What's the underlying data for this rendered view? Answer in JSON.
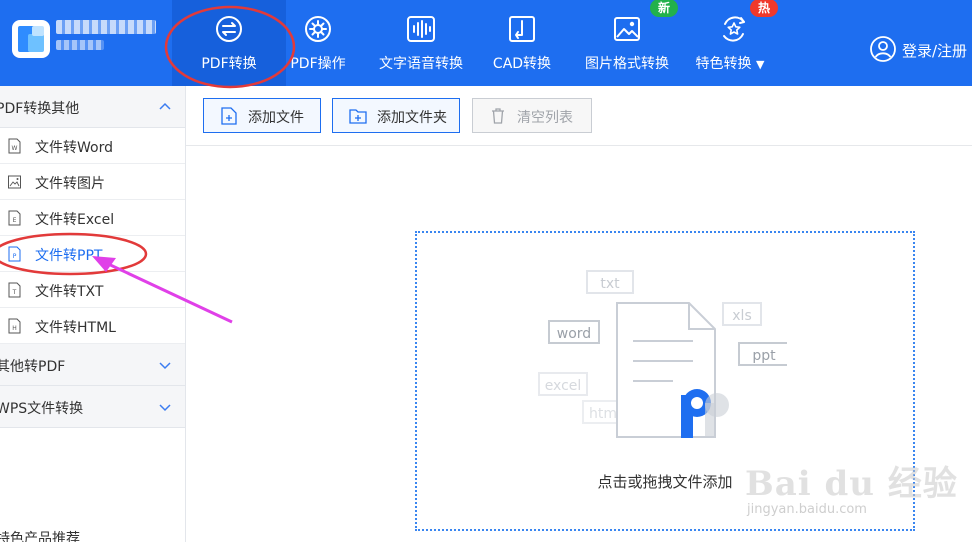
{
  "nav": {
    "items": [
      {
        "label": "PDF转换",
        "icon": "convert-arrows-icon"
      },
      {
        "label": "PDF操作",
        "icon": "gear-icon"
      },
      {
        "label": "文字语音转换",
        "icon": "waveform-icon"
      },
      {
        "label": "CAD转换",
        "icon": "cad-icon"
      },
      {
        "label": "图片格式转换",
        "icon": "image-icon"
      },
      {
        "label": "特色转换",
        "icon": "star-refresh-icon",
        "has_dropdown": true
      }
    ],
    "badge_new": "新",
    "badge_hot": "热",
    "login_label": "登录/注册"
  },
  "sidebar": {
    "group_pdf": "PDF转换其他",
    "items": [
      {
        "label": "文件转Word",
        "icon": "word-file-icon",
        "glyph": "W"
      },
      {
        "label": "文件转图片",
        "icon": "image-file-icon",
        "glyph": ""
      },
      {
        "label": "文件转Excel",
        "icon": "excel-file-icon",
        "glyph": "E"
      },
      {
        "label": "文件转PPT",
        "icon": "ppt-file-icon",
        "glyph": "P",
        "active": true
      },
      {
        "label": "文件转TXT",
        "icon": "txt-file-icon",
        "glyph": "T"
      },
      {
        "label": "文件转HTML",
        "icon": "html-file-icon",
        "glyph": "H"
      }
    ],
    "group_other": "其他转PDF",
    "group_wps": "WPS文件转换",
    "recommend": "特色产品推荐"
  },
  "toolbar": {
    "add_file": "添加文件",
    "add_folder": "添加文件夹",
    "clear_list": "清空列表"
  },
  "dropzone": {
    "text": "点击或拖拽文件添加",
    "formats": [
      "txt",
      "word",
      "xls",
      "ppt",
      "excel",
      "html"
    ]
  },
  "watermark": {
    "main": "Bai du 经验",
    "sub": "jingyan.baidu.com"
  },
  "colors": {
    "brand": "#1e6ef0",
    "active_nav": "#1660dc",
    "badge_new": "#22b14c",
    "badge_hot": "#f0392b",
    "annotation_red": "#e23a3a",
    "annotation_arrow": "#e040e8"
  }
}
